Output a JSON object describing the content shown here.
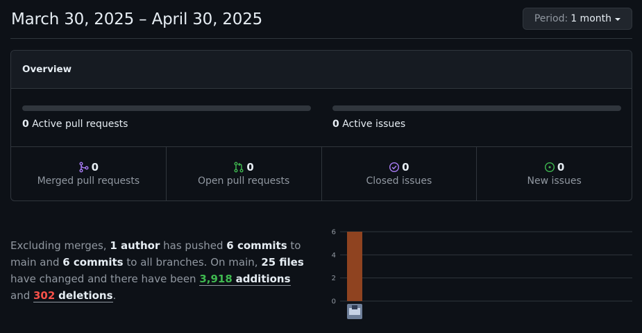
{
  "header": {
    "title": "March 30, 2025 – April 30, 2025",
    "period_label": "Period:",
    "period_value": "1 month"
  },
  "overview": {
    "title": "Overview",
    "active_pull_requests": {
      "count": "0",
      "label": "Active pull requests",
      "fill": 0
    },
    "active_issues": {
      "count": "0",
      "label": "Active issues",
      "fill": 0
    },
    "stats": [
      {
        "count": "0",
        "label": "Merged pull requests",
        "icon": "git-merge-icon",
        "color": "#ab7df8"
      },
      {
        "count": "0",
        "label": "Open pull requests",
        "icon": "git-pull-request-icon",
        "color": "#3fb950"
      },
      {
        "count": "0",
        "label": "Closed issues",
        "icon": "issue-closed-icon",
        "color": "#ab7df8"
      },
      {
        "count": "0",
        "label": "New issues",
        "icon": "issue-opened-icon",
        "color": "#3fb950"
      }
    ]
  },
  "summary": {
    "t1": "Excluding merges, ",
    "authors": "1 author",
    "t2": " has pushed ",
    "commits_main": "6 commits",
    "t3": " to main and ",
    "commits_all": "6 commits",
    "t4": " to all branches. On main, ",
    "files": "25 files",
    "t5": " have changed and there have been ",
    "additions_num": "3,918",
    "additions_word": "additions",
    "t6": " and ",
    "deletions_num": "302",
    "deletions_word": "deletions",
    "t7": "."
  },
  "chart_data": {
    "type": "bar",
    "categories": [
      "author-avatar"
    ],
    "values": [
      6
    ],
    "ylim": [
      0,
      6
    ],
    "yticks": [
      "0",
      "2",
      "4",
      "6"
    ],
    "grid": true,
    "bar_color": "#8f4320"
  }
}
